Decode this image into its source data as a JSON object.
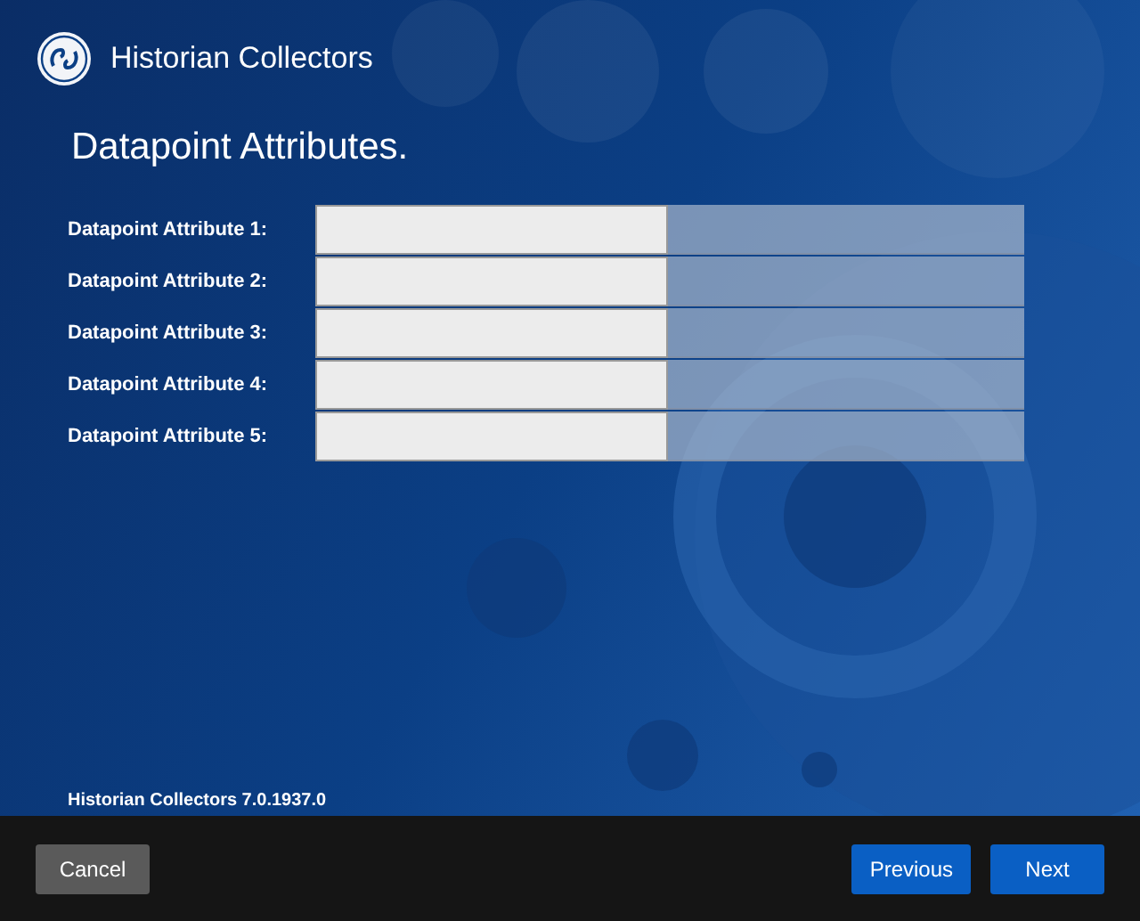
{
  "header": {
    "title": "Historian Collectors"
  },
  "page": {
    "heading": "Datapoint Attributes."
  },
  "attributes": [
    {
      "label": "Datapoint Attribute 1:"
    },
    {
      "label": "Datapoint Attribute 2:"
    },
    {
      "label": "Datapoint Attribute 3:"
    },
    {
      "label": "Datapoint Attribute 4:"
    },
    {
      "label": "Datapoint Attribute 5:"
    }
  ],
  "version": "Historian Collectors 7.0.1937.0",
  "buttons": [
    {
      "label": "Cancel",
      "kind": "secondary"
    },
    {
      "label": "Previous",
      "kind": "primary"
    },
    {
      "label": "Next",
      "kind": "primary"
    }
  ]
}
